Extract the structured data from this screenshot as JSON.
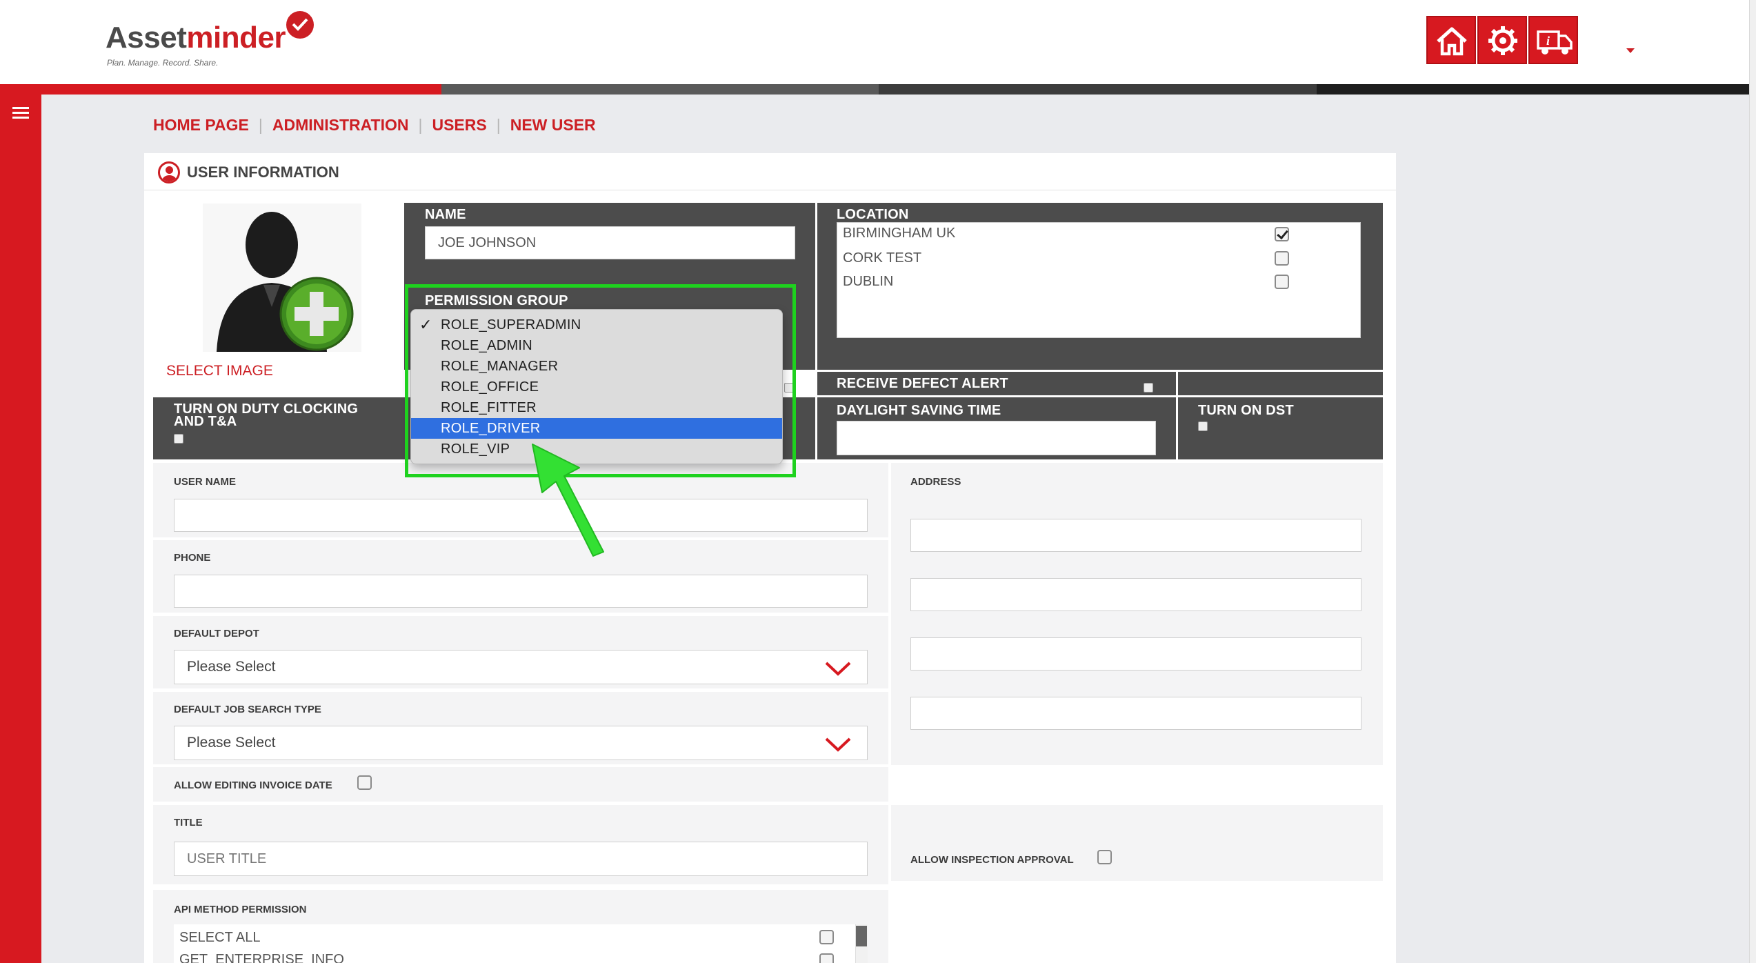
{
  "header": {
    "logo_primary": "Asset",
    "logo_accent": "minder",
    "logo_tagline": "Plan. Manage. Record. Share.",
    "buttons": [
      "home-icon",
      "settings-gear-icon",
      "vehicle-info-icon"
    ],
    "accent_color": "#d71920"
  },
  "breadcrumb": {
    "items": [
      "HOME PAGE",
      "ADMINISTRATION",
      "USERS",
      "NEW USER"
    ],
    "separator": "|"
  },
  "panel": {
    "title": "USER INFORMATION",
    "select_image": "SELECT IMAGE"
  },
  "name": {
    "label": "NAME",
    "value": "JOE JOHNSON"
  },
  "permission_group": {
    "label": "PERMISSION GROUP",
    "options": [
      "ROLE_SUPERADMIN",
      "ROLE_ADMIN",
      "ROLE_MANAGER",
      "ROLE_OFFICE",
      "ROLE_FITTER",
      "ROLE_DRIVER",
      "ROLE_VIP"
    ],
    "checked_option": "ROLE_SUPERADMIN",
    "highlighted_option": "ROLE_DRIVER"
  },
  "location": {
    "label": "LOCATION",
    "items": [
      {
        "name": "BIRMINGHAM UK",
        "checked": true
      },
      {
        "name": "CORK TEST",
        "checked": false
      },
      {
        "name": "DUBLIN",
        "checked": false
      }
    ]
  },
  "toggles": {
    "receive_defect_alert": "RECEIVE DEFECT ALERT",
    "duty_clocking_line1": "TURN ON DUTY CLOCKING",
    "duty_clocking_line2": "AND T&A",
    "daylight_saving": "DAYLIGHT SAVING TIME",
    "turn_on_dst": "TURN ON DST"
  },
  "form": {
    "user_name": {
      "label": "USER NAME",
      "value": ""
    },
    "phone": {
      "label": "PHONE",
      "value": ""
    },
    "default_depot": {
      "label": "DEFAULT DEPOT",
      "value": "Please Select"
    },
    "default_job_search_type": {
      "label": "DEFAULT JOB SEARCH TYPE",
      "value": "Please Select"
    },
    "allow_editing_invoice_date": "ALLOW EDITING INVOICE DATE",
    "title": {
      "label": "TITLE",
      "placeholder": "USER TITLE"
    },
    "address": {
      "label": "ADDRESS"
    },
    "allow_inspection_approval": "ALLOW INSPECTION APPROVAL",
    "api_method_permission": {
      "label": "API METHOD PERMISSION",
      "items": [
        "SELECT ALL",
        "GET_ENTERPRISE_INFO"
      ]
    }
  }
}
